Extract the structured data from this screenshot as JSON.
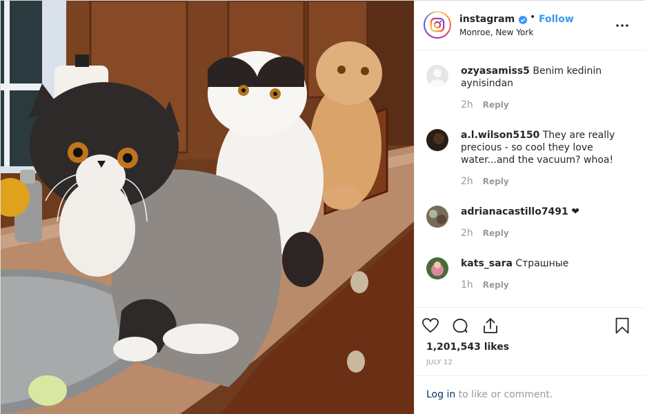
{
  "post": {
    "username": "instagram",
    "follow_label": "Follow",
    "location": "Monroe, New York",
    "dot": "•"
  },
  "comments": [
    {
      "user": "ozyasamiss5",
      "text": "Benim kedinin aynisindan",
      "time": "2h",
      "reply": "Reply",
      "avatar_color": "#e8e8e8"
    },
    {
      "user": "a.l.wilson5150",
      "text": "They are really precious - so cool they love water...and the vacuum? whoa!",
      "time": "2h",
      "reply": "Reply",
      "avatar_color": "#2b1d14"
    },
    {
      "user": "adrianacastillo7491",
      "text": "❤",
      "time": "2h",
      "reply": "Reply",
      "avatar_color": "#7a6a5a"
    },
    {
      "user": "kats_sara",
      "text": "Страшные",
      "time": "1h",
      "reply": "Reply",
      "avatar_color": "#d98aa0"
    }
  ],
  "actions": {
    "likes": "1,201,543 likes",
    "date": "JULY 12"
  },
  "login": {
    "link": "Log in",
    "rest": " to like or comment."
  },
  "colors": {
    "accent": "#3897f0",
    "verified": "#3897f0",
    "link": "#003569",
    "muted": "#999999"
  },
  "icons": [
    "instagram-logo-icon",
    "verified-badge-icon",
    "more-options-icon",
    "heart-icon",
    "comment-icon",
    "share-icon",
    "bookmark-icon"
  ]
}
